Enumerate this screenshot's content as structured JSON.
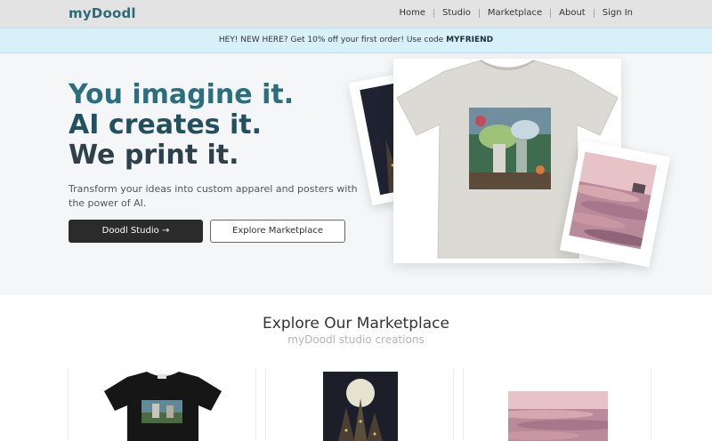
{
  "header": {
    "logo": "myDoodl",
    "nav": [
      "Home",
      "Studio",
      "Marketplace",
      "About",
      "Sign In"
    ]
  },
  "banner": {
    "text": "HEY! NEW HERE? Get 10% off your first order! Use code ",
    "code": "MYFRIEND"
  },
  "hero": {
    "headline": [
      "You imagine it.",
      "AI creates it.",
      "We print it."
    ],
    "subtitle": "Transform your ideas into custom apparel and posters with the power of AI.",
    "primary_button": "Doodl Studio →",
    "secondary_button": "Explore Marketplace"
  },
  "marketplace": {
    "title": "Explore Our Marketplace",
    "subtitle": "myDoodl studio creations",
    "products": [
      {
        "name": "black t-shirt"
      },
      {
        "name": "moon castle poster"
      },
      {
        "name": "pink seascape print"
      }
    ]
  },
  "colors": {
    "brand": "#2d6b78",
    "banner_bg": "#d8f1f8",
    "primary_button": "#2b2b2b"
  }
}
